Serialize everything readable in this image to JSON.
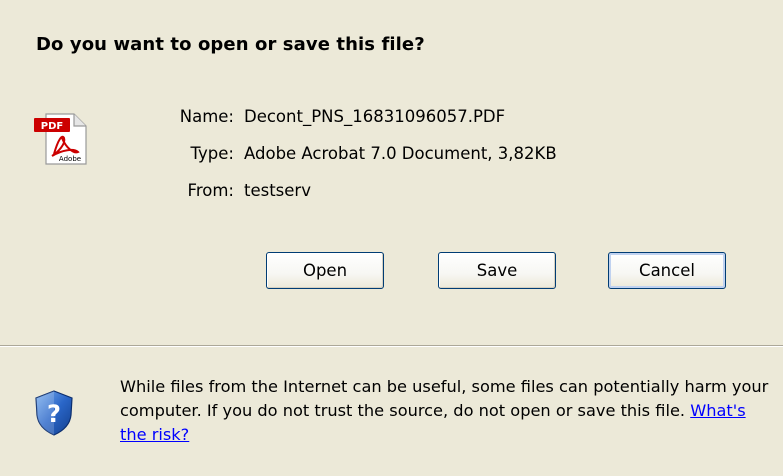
{
  "dialog": {
    "title": "Do you want to open or save this file?"
  },
  "file": {
    "icon": "adobe-pdf-icon",
    "name_label": "Name:",
    "name_value": "Decont_PNS_16831096057.PDF",
    "type_label": "Type:",
    "type_value": "Adobe Acrobat 7.0 Document, 3,82KB",
    "from_label": "From:",
    "from_value": "testserv"
  },
  "buttons": {
    "open": "Open",
    "save": "Save",
    "cancel": "Cancel"
  },
  "warning": {
    "icon": "security-shield-question-icon",
    "text": "While files from the Internet can be useful, some files can potentially harm your computer. If you do not trust the source, do not open or save this file.",
    "link": "What's the risk?"
  },
  "colors": {
    "background": "#ece9d8",
    "link": "#0000ff",
    "button_border": "#003c74",
    "pdf_red": "#cc0000"
  }
}
